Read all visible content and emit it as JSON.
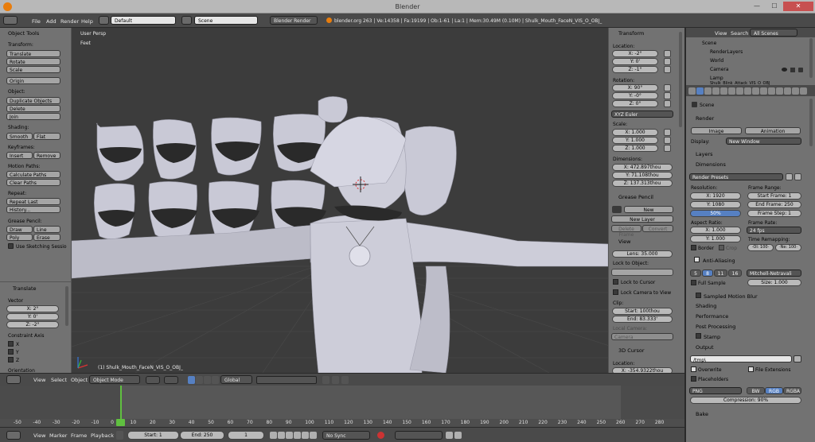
{
  "window": {
    "title": "Blender",
    "minimize": "—",
    "maximize": "☐",
    "close": "✕"
  },
  "info_header": {
    "menus": [
      "File",
      "Add",
      "Render",
      "Help"
    ],
    "layout": "Default",
    "scene": "Scene",
    "engine": "Blender Render",
    "stats": "blender.org 263 | Ve:14358 | Fa:19199 | Ob:1-61 | La:1 | Mem:30.49M (0.10M) | Shulk_Mouth_FaceN_VIS_O_OBJ_"
  },
  "tool_shelf": {
    "title": "Object Tools",
    "transform_label": "Transform:",
    "transform": [
      "Translate",
      "Rotate",
      "Scale"
    ],
    "origin": "Origin",
    "object_label": "Object:",
    "object": [
      "Duplicate Objects",
      "Delete",
      "Join"
    ],
    "shading_label": "Shading:",
    "shading": [
      "Smooth",
      "Flat"
    ],
    "keyframes_label": "Keyframes:",
    "keyframes": [
      "Insert",
      "Remove"
    ],
    "motion_label": "Motion Paths:",
    "motion": [
      "Calculate Paths",
      "Clear Paths"
    ],
    "repeat_label": "Repeat:",
    "repeat": [
      "Repeat Last",
      "History..."
    ],
    "grease_label": "Grease Pencil:",
    "grease": [
      "Draw",
      "Line",
      "Poly",
      "Erase"
    ],
    "sketching": "Use Sketching Sessio",
    "operator_title": "Translate",
    "vector_label": "Vector",
    "vector": [
      "X: 2°",
      "Y: 0'",
      "Z: -2°"
    ],
    "constraint_label": "Constraint Axis",
    "axes": [
      "X",
      "Y",
      "Z"
    ],
    "orientation_label": "Orientation"
  },
  "viewport": {
    "view_name": "User Persp",
    "units": "Feet",
    "object_name": "(1) Shulk_Mouth_FaceN_VIS_O_OBJ_"
  },
  "n_panel": {
    "transform_title": "Transform",
    "location_label": "Location:",
    "location": [
      "X: -2°",
      "Y: 0'",
      "Z: -1°"
    ],
    "rotation_label": "Rotation:",
    "rotation": [
      "X: 90°",
      "Y: -0°",
      "Z: 0°"
    ],
    "rotation_mode": "XYZ Euler",
    "scale_label": "Scale:",
    "scale": [
      "X: 1.000",
      "Y: 1.000",
      "Z: 1.000"
    ],
    "dimensions_label": "Dimensions:",
    "dimensions": [
      "X: 472.897thou",
      "Y: 71.108thou",
      "Z: 137.313thou"
    ],
    "grease_title": "Grease Pencil",
    "new": "New",
    "new_layer": "New Layer",
    "delete_frame": "Delete Frame",
    "convert": "Convert",
    "view_title": "View",
    "lens": "Lens: 35.000",
    "lock_to_object": "Lock to Object:",
    "lock_to_cursor": "Lock to Cursor",
    "lock_camera": "Lock Camera to View",
    "clip_label": "Clip:",
    "clip_start": "Start: 100thou",
    "clip_end": "End: 83.333'",
    "local_camera": "Local Camera:",
    "camera": "Camera",
    "cursor_title": "3D Cursor",
    "cursor_location_label": "Location:",
    "cursor_x": "X: -354.9322thou"
  },
  "outliner": {
    "menus": [
      "View",
      "Search"
    ],
    "filter": "All Scenes",
    "items": [
      "Scene",
      "RenderLayers",
      "World",
      "Camera",
      "Lamp",
      "Shulk_Blink_Attack_VIS_O_OBJ"
    ]
  },
  "properties": {
    "context": "Scene",
    "render_title": "Render",
    "image_btn": "Image",
    "animation_btn": "Animation",
    "display_label": "Display:",
    "display_value": "New Window",
    "layers": "Layers",
    "dimensions": "Dimensions",
    "render_presets": "Render Presets",
    "resolution_label": "Resolution:",
    "res_x": "X: 1920",
    "res_y": "Y: 1080",
    "res_pct": "50%",
    "frame_range_label": "Frame Range:",
    "start_frame": "Start Frame: 1",
    "end_frame": "End Frame: 250",
    "frame_step": "Frame Step: 1",
    "aspect_label": "Aspect Ratio:",
    "aspect_x": "X: 1.000",
    "aspect_y": "Y: 1.000",
    "frame_rate_label": "Frame Rate:",
    "fps": "24 fps",
    "time_remap_label": "Time Remapping:",
    "old": "·Ol: 100·",
    "new": "·Ne: 100·",
    "border": "Border",
    "crop": "Crop",
    "anti_aliasing": "Anti-Aliasing",
    "aa_samples": [
      "5",
      "8",
      "11",
      "16"
    ],
    "aa_filter": "Mitchell-Netravali",
    "full_sample": "Full Sample",
    "size": "Size: 1.000",
    "motion_blur": "Sampled Motion Blur",
    "shading": "Shading",
    "performance": "Performance",
    "post_processing": "Post Processing",
    "stamp": "Stamp",
    "output": "Output",
    "output_path": "/tmp\\",
    "overwrite": "Overwrite",
    "file_ext": "File Extensions",
    "placeholders": "Placeholders",
    "format": "PNG",
    "color_modes": [
      "BW",
      "RGB",
      "RGBA"
    ],
    "compression": "Compression: 90%",
    "bake": "Bake"
  },
  "view3d_header": {
    "menus": [
      "View",
      "Select",
      "Object"
    ],
    "mode": "Object Mode",
    "orientation": "Global"
  },
  "timeline": {
    "ticks": [
      "-50",
      "-40",
      "-30",
      "-20",
      "-10",
      "0",
      "10",
      "20",
      "30",
      "40",
      "50",
      "60",
      "70",
      "80",
      "90",
      "100",
      "110",
      "120",
      "130",
      "140",
      "150",
      "160",
      "170",
      "180",
      "190",
      "200",
      "210",
      "220",
      "230",
      "240",
      "250",
      "260",
      "270",
      "280"
    ],
    "menus": [
      "View",
      "Marker",
      "Frame",
      "Playback"
    ],
    "start": "Start: 1",
    "end": "End: 250",
    "current": "1",
    "sync": "No Sync"
  },
  "colors": {
    "panel_bg": "#727272",
    "header_bg": "#4a4a4a",
    "viewport_bg": "#3c3c3c",
    "mesh": "#c8c8d4",
    "active_blue": "#5680c2",
    "current_frame": "#60c040"
  }
}
